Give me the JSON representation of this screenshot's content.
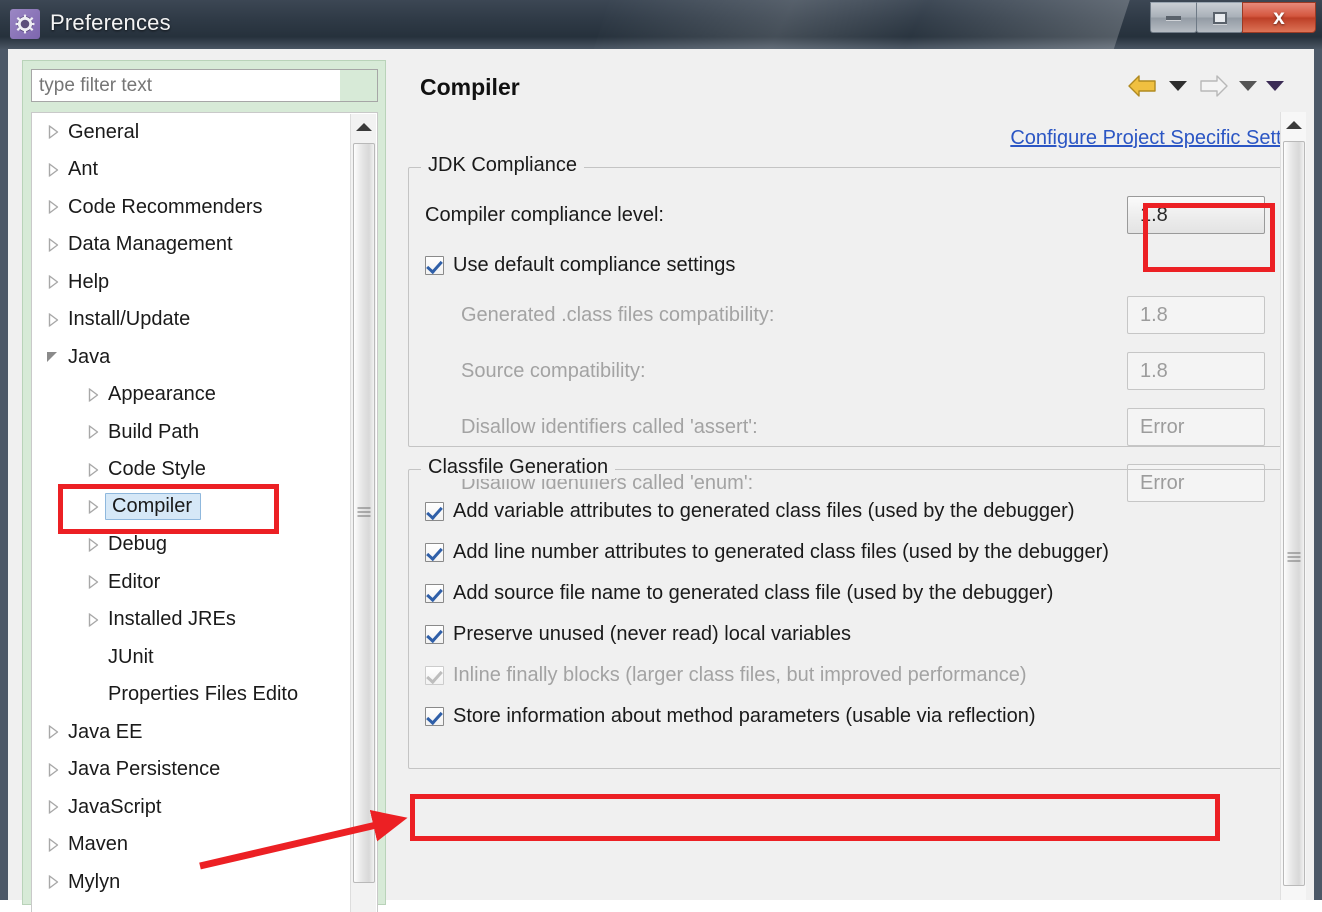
{
  "window": {
    "title": "Preferences",
    "icon": "gear-icon",
    "controls": {
      "minimize": "–",
      "maximize": "□",
      "close": "x"
    }
  },
  "sidebar": {
    "filter": {
      "placeholder": "type filter text",
      "value": ""
    },
    "tree": [
      {
        "label": "General",
        "level": 0,
        "state": "collapsed",
        "selected": false
      },
      {
        "label": "Ant",
        "level": 0,
        "state": "collapsed",
        "selected": false
      },
      {
        "label": "Code Recommenders",
        "level": 0,
        "state": "collapsed",
        "selected": false
      },
      {
        "label": "Data Management",
        "level": 0,
        "state": "collapsed",
        "selected": false
      },
      {
        "label": "Help",
        "level": 0,
        "state": "collapsed",
        "selected": false
      },
      {
        "label": "Install/Update",
        "level": 0,
        "state": "collapsed",
        "selected": false
      },
      {
        "label": "Java",
        "level": 0,
        "state": "expanded",
        "selected": false
      },
      {
        "label": "Appearance",
        "level": 1,
        "state": "collapsed",
        "selected": false
      },
      {
        "label": "Build Path",
        "level": 1,
        "state": "collapsed",
        "selected": false
      },
      {
        "label": "Code Style",
        "level": 1,
        "state": "collapsed",
        "selected": false
      },
      {
        "label": "Compiler",
        "level": 1,
        "state": "collapsed",
        "selected": true
      },
      {
        "label": "Debug",
        "level": 1,
        "state": "collapsed",
        "selected": false
      },
      {
        "label": "Editor",
        "level": 1,
        "state": "collapsed",
        "selected": false
      },
      {
        "label": "Installed JREs",
        "level": 1,
        "state": "collapsed",
        "selected": false
      },
      {
        "label": "JUnit",
        "level": 1,
        "state": "leaf",
        "selected": false
      },
      {
        "label": "Properties Files Edito",
        "level": 1,
        "state": "leaf",
        "selected": false
      },
      {
        "label": "Java EE",
        "level": 0,
        "state": "collapsed",
        "selected": false
      },
      {
        "label": "Java Persistence",
        "level": 0,
        "state": "collapsed",
        "selected": false
      },
      {
        "label": "JavaScript",
        "level": 0,
        "state": "collapsed",
        "selected": false
      },
      {
        "label": "Maven",
        "level": 0,
        "state": "collapsed",
        "selected": false
      },
      {
        "label": "Mylyn",
        "level": 0,
        "state": "collapsed",
        "selected": false
      }
    ]
  },
  "panel": {
    "title": "Compiler",
    "nav": {
      "back": "back-arrow",
      "back_menu": "chevron-down-icon",
      "forward": "forward-arrow",
      "forward_menu": "chevron-down-icon",
      "view_menu": "chevron-down-icon"
    },
    "configure_link": "Configure Project Specific Setti",
    "jdk_compliance": {
      "legend": "JDK Compliance",
      "compliance_level_label": "Compiler compliance level:",
      "compliance_level_value": "1.8",
      "use_defaults_label": "Use default compliance settings",
      "use_defaults_checked": true,
      "fields": [
        {
          "label": "Generated .class files compatibility:",
          "value": "1.8",
          "enabled": false
        },
        {
          "label": "Source compatibility:",
          "value": "1.8",
          "enabled": false
        },
        {
          "label": "Disallow identifiers called 'assert':",
          "value": "Error",
          "enabled": false
        },
        {
          "label": "Disallow identifiers called 'enum':",
          "value": "Error",
          "enabled": false
        }
      ]
    },
    "classfile_generation": {
      "legend": "Classfile Generation",
      "options": [
        {
          "label": "Add variable attributes to generated class files (used by the debugger)",
          "checked": true,
          "enabled": true
        },
        {
          "label": "Add line number attributes to generated class files (used by the debugger)",
          "checked": true,
          "enabled": true
        },
        {
          "label": "Add source file name to generated class file (used by the debugger)",
          "checked": true,
          "enabled": true
        },
        {
          "label": "Preserve unused (never read) local variables",
          "checked": true,
          "enabled": true
        },
        {
          "label": "Inline finally blocks (larger class files, but improved performance)",
          "checked": true,
          "enabled": false
        },
        {
          "label": "Store information about method parameters (usable via reflection)",
          "checked": true,
          "enabled": true
        }
      ]
    }
  },
  "annotations": {
    "highlight_color": "#ec2024",
    "boxes": [
      {
        "name": "compiler-compliance-level-value"
      },
      {
        "name": "tree-item-compiler"
      },
      {
        "name": "store-method-parameters-option"
      }
    ],
    "arrow": {
      "name": "pointer-arrow-to-store-option"
    }
  },
  "colors": {
    "titlebar": "#2f3a46",
    "sidebar_bg": "#d7ead7",
    "panel_bg": "#f0f0f0",
    "link": "#2b56c4",
    "selection": "#d6e8f7",
    "annotation": "#ec2024",
    "close_button": "#c4452c"
  }
}
